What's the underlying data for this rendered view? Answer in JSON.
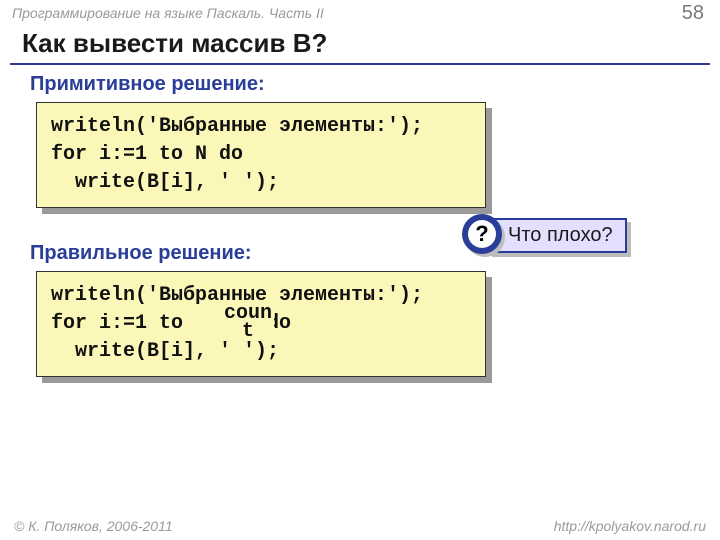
{
  "header": {
    "left": "Программирование на языке Паскаль. Часть II",
    "page": "58"
  },
  "title": "Как вывести массив B?",
  "sections": {
    "primitive": {
      "label": "Примитивное решение:",
      "code": "writeln('Выбранные элементы:');\nfor i:=1 to N do\n  write(B[i], ' ');"
    },
    "correct": {
      "label": "Правильное решение:",
      "code": "writeln('Выбранные элементы:');\nfor i:=1 to       do\n  write(B[i], ' ');",
      "overlay": "coun\nt"
    }
  },
  "callout": {
    "mark": "?",
    "text": "Что плохо?"
  },
  "footer": {
    "left": "© К. Поляков, 2006-2011",
    "right": "http://kpolyakov.narod.ru"
  }
}
